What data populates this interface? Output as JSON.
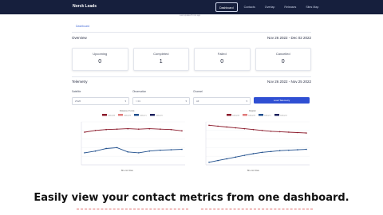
{
  "app": {
    "brand": "Norck Leads"
  },
  "nav": [
    "Dashboard",
    "Contacts",
    "Overlap",
    "Releases",
    "Sites Map"
  ],
  "strip_text": "Last updated 5 min ago",
  "breadcrumb": "Dashboard",
  "overview": {
    "title": "Overview",
    "range": "Nov 26 2022 - Dec 02 2022",
    "cards": [
      {
        "label": "Upcoming",
        "value": "0"
      },
      {
        "label": "Completed",
        "value": "1"
      },
      {
        "label": "Failed",
        "value": "0"
      },
      {
        "label": "Cancelled",
        "value": "0"
      }
    ]
  },
  "telemetry": {
    "title": "Telemetry",
    "range": "Nov 26 2022 - Nov 25 2022",
    "filters": [
      {
        "label": "Satellite",
        "value": "ZS26"
      },
      {
        "label": "Observation",
        "value": "> 01"
      },
      {
        "label": "Channel",
        "value": "All"
      }
    ],
    "load_button": "Load Telemetry"
  },
  "chart_data": [
    {
      "type": "line",
      "title": "Distance (T-min)",
      "x": [
        "1",
        "2",
        "3",
        "4",
        "5",
        "6",
        "7",
        "8",
        "9",
        "10"
      ],
      "series": [
        {
          "name": "Contact A",
          "color": "#8b1a2b",
          "values": [
            76,
            80,
            82,
            83,
            84,
            83,
            84,
            83,
            82,
            79
          ]
        },
        {
          "name": "Contact B",
          "color": "#e07b7b",
          "values": [
            0,
            0,
            0,
            0,
            0,
            0,
            0,
            0,
            0,
            0
          ]
        },
        {
          "name": "Contact C",
          "color": "#1f4e8c",
          "values": [
            28,
            32,
            38,
            40,
            30,
            28,
            32,
            34,
            35,
            36
          ]
        },
        {
          "name": "Contact D",
          "color": "#1a1f5c",
          "values": [
            0,
            0,
            0,
            0,
            0,
            0,
            0,
            0,
            0,
            0
          ]
        }
      ],
      "ylim": [
        0,
        100
      ]
    },
    {
      "type": "line",
      "title": "Doppler",
      "x": [
        "1",
        "2",
        "3",
        "4",
        "5",
        "6",
        "7",
        "8",
        "9",
        "10",
        "11",
        "12"
      ],
      "series": [
        {
          "name": "Contact A",
          "color": "#8b1a2b",
          "values": [
            92,
            90,
            88,
            86,
            84,
            82,
            80,
            78,
            77,
            76,
            75,
            74
          ]
        },
        {
          "name": "Contact B",
          "color": "#e07b7b",
          "values": [
            0,
            0,
            0,
            0,
            0,
            0,
            0,
            0,
            0,
            0,
            0,
            0
          ]
        },
        {
          "name": "Contact C",
          "color": "#1f4e8c",
          "values": [
            6,
            10,
            14,
            18,
            22,
            26,
            29,
            31,
            33,
            34,
            35,
            36
          ]
        },
        {
          "name": "Contact D",
          "color": "#1a1f5c",
          "values": [
            0,
            0,
            0,
            0,
            0,
            0,
            0,
            0,
            0,
            0,
            0,
            0
          ]
        }
      ],
      "ylim": [
        0,
        100
      ]
    }
  ],
  "lower_charts": [
    "Bit error Rate",
    "Bit error Rate"
  ],
  "caption": "Easily view your contact metrics from one dashboard.",
  "colors": {
    "topbar": "#161f3d",
    "accent": "#2f4fd3"
  }
}
